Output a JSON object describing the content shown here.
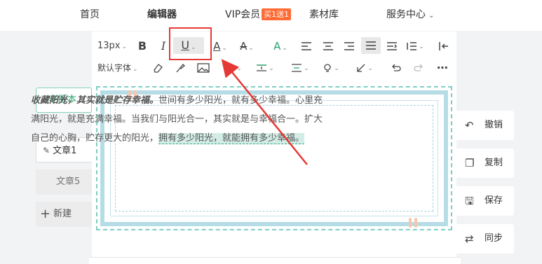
{
  "nav": {
    "home": "首页",
    "editor": "编辑器",
    "vip": "VIP会员",
    "vip_badge": "买1送1",
    "materials": "素材库",
    "service": "服务中心"
  },
  "sidebar": {
    "old_version": "老版本",
    "article_1": "文章1",
    "article_5": "文章5",
    "new": "新建"
  },
  "toolbar": {
    "font_size": "13px",
    "font_family": "默认字体",
    "active_tool": "underline"
  },
  "content": {
    "bold_text": "收藏阳光，其实就是贮存幸福。",
    "normal_text": "世间有多少阳光，就有多少幸福。心里充满阳光，就是充满幸福。当我们与阳光合一，其实就是与幸福合一。扩大自己的心胸，贮存更大的阳光，",
    "highlight_text": "拥有多少阳光，就能拥有多少幸福。"
  },
  "actions": {
    "undo": "撤销",
    "copy": "复制",
    "save": "保存",
    "sync": "同步"
  },
  "colors": {
    "accent_green": "#28a46e",
    "annotation_red": "#e53935",
    "frame_blue": "#b6dde6"
  }
}
